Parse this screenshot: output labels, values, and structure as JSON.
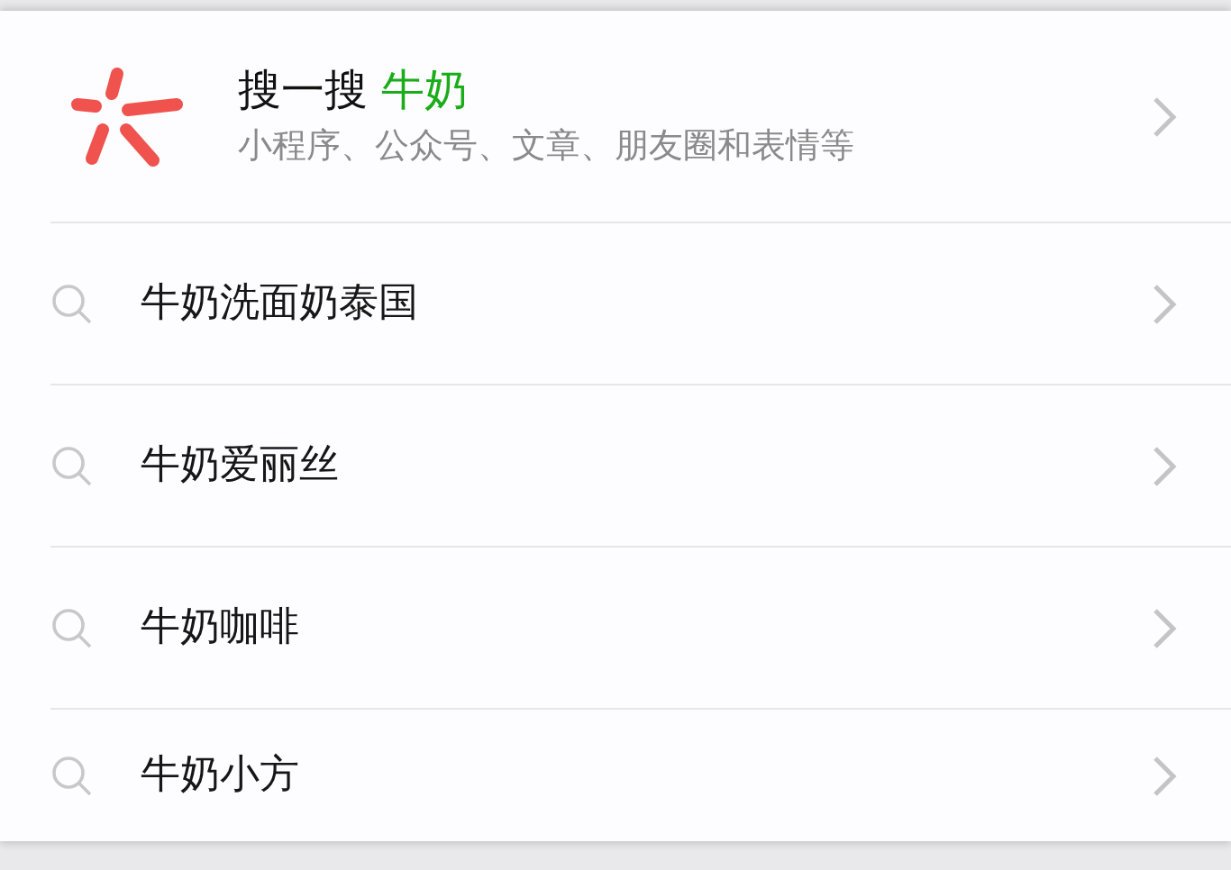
{
  "header": {
    "label": "搜一搜",
    "query": "牛奶",
    "subtitle": "小程序、公众号、文章、朋友圈和表情等"
  },
  "suggestions": [
    {
      "text": "牛奶洗面奶泰国"
    },
    {
      "text": "牛奶爱丽丝"
    },
    {
      "text": "牛奶咖啡"
    },
    {
      "text": "牛奶小方"
    }
  ]
}
